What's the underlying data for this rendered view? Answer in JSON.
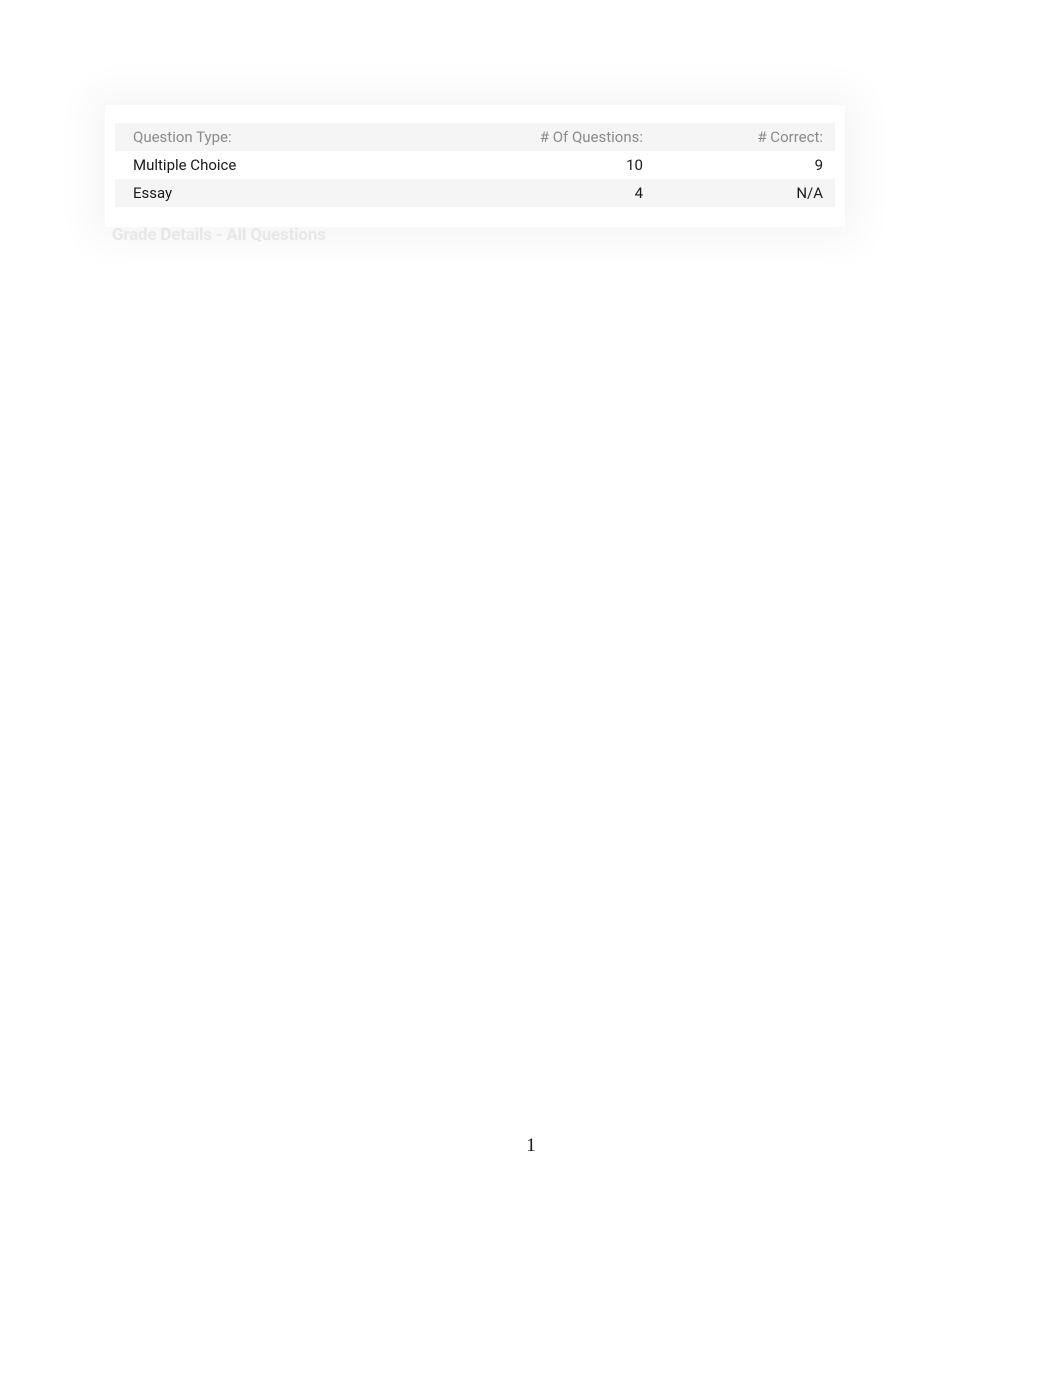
{
  "table": {
    "headers": {
      "type": "Question Type:",
      "questions": "# Of Questions:",
      "correct": "# Correct:"
    },
    "rows": [
      {
        "type": "Multiple Choice",
        "questions": "10",
        "correct": "9"
      },
      {
        "type": "Essay",
        "questions": "4",
        "correct": "N/A"
      }
    ]
  },
  "section_heading": "Grade Details - All Questions",
  "page_number": "1"
}
